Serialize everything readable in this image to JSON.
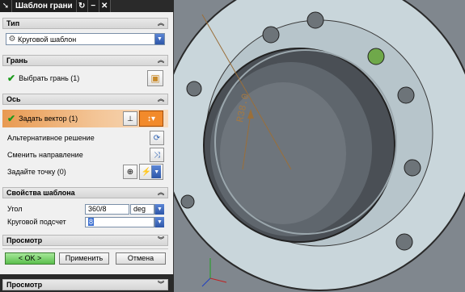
{
  "titlebar": {
    "title": "Шаблон грани",
    "icons": [
      "pin-icon",
      "reset-icon",
      "minimize-icon",
      "close-icon"
    ]
  },
  "type_section": {
    "header": "Тип",
    "combo_value": "Круговой шаблон"
  },
  "face_section": {
    "header": "Грань",
    "select_label": "Выбрать грань (1)"
  },
  "axis_section": {
    "header": "Ось",
    "vector_label": "Задать вектор (1)",
    "alt_label": "Альтернативное решение",
    "flip_label": "Сменить направление",
    "point_label": "Задайте точку (0)"
  },
  "props_section": {
    "header": "Свойства шаблона",
    "angle_label": "Угол",
    "angle_value": "360/8",
    "angle_unit": "deg",
    "count_label": "Круговой подсчет",
    "count_value": "8"
  },
  "preview_section": {
    "header": "Просмотр"
  },
  "buttons": {
    "ok": "< OK >",
    "apply": "Применить",
    "cancel": "Отмена"
  },
  "bottom_bar": {
    "header": "Просмотр"
  },
  "viewport": {
    "dimension_label": "R38.0"
  },
  "colors": {
    "accent": "#e89a52",
    "check": "#1b9a1b",
    "part": "#c8d6db"
  }
}
